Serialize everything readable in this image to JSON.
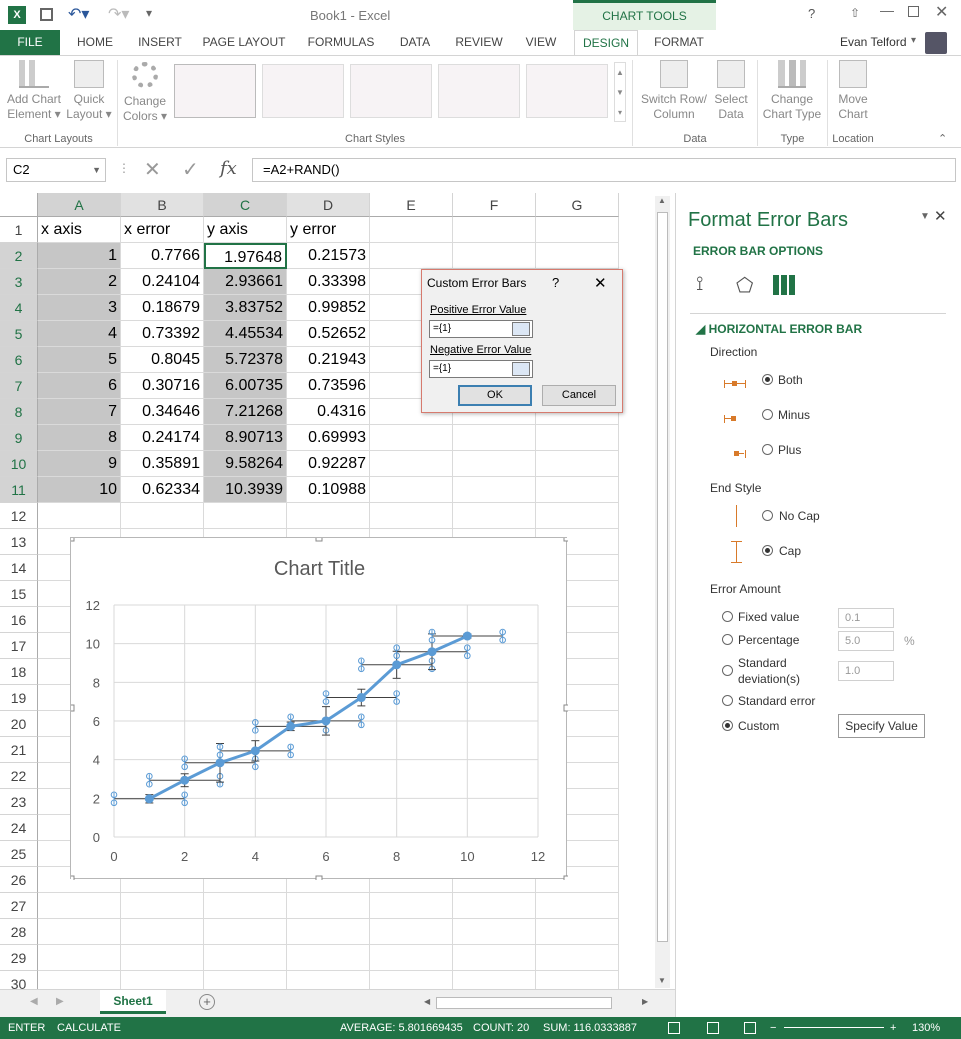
{
  "window": {
    "title": "Book1 - Excel",
    "chart_tools": "CHART TOOLS",
    "user": "Evan Telford"
  },
  "tabs": [
    "FILE",
    "HOME",
    "INSERT",
    "PAGE LAYOUT",
    "FORMULAS",
    "DATA",
    "REVIEW",
    "VIEW",
    "DESIGN",
    "FORMAT"
  ],
  "ribbon": {
    "add_chart": [
      "Add Chart",
      "Element ▾"
    ],
    "quick_layout": [
      "Quick",
      "Layout ▾"
    ],
    "change_colors": [
      "Change",
      "Colors ▾"
    ],
    "switch_row": [
      "Switch Row/",
      "Column"
    ],
    "select_data": [
      "Select",
      "Data"
    ],
    "change_type": [
      "Change",
      "Chart Type"
    ],
    "move_chart": [
      "Move",
      "Chart"
    ],
    "groups": {
      "layouts": "Chart Layouts",
      "styles": "Chart Styles",
      "data": "Data",
      "type": "Type",
      "location": "Location"
    }
  },
  "formula_bar": {
    "name_box": "C2",
    "fx": "fx",
    "formula": "=A2+RAND()"
  },
  "columns": [
    "A",
    "B",
    "C",
    "D",
    "E",
    "F",
    "G"
  ],
  "rows": [
    "1",
    "2",
    "3",
    "4",
    "5",
    "6",
    "7",
    "8",
    "9",
    "10",
    "11",
    "12",
    "13",
    "14",
    "15",
    "16",
    "17",
    "18",
    "19",
    "20",
    "21",
    "22",
    "23",
    "24",
    "25",
    "26",
    "27",
    "28",
    "29",
    "30"
  ],
  "sheet": {
    "headers": [
      "x axis",
      "x error",
      "y axis",
      "y error"
    ],
    "data": [
      [
        "1",
        "0.7766",
        "1.97648",
        "0.21573"
      ],
      [
        "2",
        "0.24104",
        "2.93661",
        "0.33398"
      ],
      [
        "3",
        "0.18679",
        "3.83752",
        "0.99852"
      ],
      [
        "4",
        "0.73392",
        "4.45534",
        "0.52652"
      ],
      [
        "5",
        "0.8045",
        "5.72378",
        "0.21943"
      ],
      [
        "6",
        "0.30716",
        "6.00735",
        "0.73596"
      ],
      [
        "7",
        "0.34646",
        "7.21268",
        "0.4316"
      ],
      [
        "8",
        "0.24174",
        "8.90713",
        "0.69993"
      ],
      [
        "9",
        "0.35891",
        "9.58264",
        "0.92287"
      ],
      [
        "10",
        "0.62334",
        "10.3939",
        "0.10988"
      ]
    ]
  },
  "chart": {
    "title": "Chart Title",
    "x_ticks": [
      "0",
      "2",
      "4",
      "6",
      "8",
      "10",
      "12"
    ],
    "y_ticks": [
      "0",
      "2",
      "4",
      "6",
      "8",
      "10",
      "12"
    ],
    "color": "#5b9bd5"
  },
  "chart_data": {
    "type": "scatter",
    "title": "Chart Title",
    "xlabel": "",
    "ylabel": "",
    "xlim": [
      0,
      12
    ],
    "ylim": [
      0,
      12
    ],
    "grid": true,
    "x": [
      1,
      2,
      3,
      4,
      5,
      6,
      7,
      8,
      9,
      10
    ],
    "y": [
      1.97648,
      2.93661,
      3.83752,
      4.45534,
      5.72378,
      6.00735,
      7.21268,
      8.90713,
      9.58264,
      10.3939
    ],
    "x_error": [
      0.7766,
      0.24104,
      0.18679,
      0.73392,
      0.8045,
      0.30716,
      0.34646,
      0.24174,
      0.35891,
      0.62334
    ],
    "y_error": [
      0.21573,
      0.33398,
      0.99852,
      0.52652,
      0.21943,
      0.73596,
      0.4316,
      0.69993,
      0.92287,
      0.10988
    ],
    "horizontal_error_bar_custom": {
      "positive": 1,
      "negative": 1
    }
  },
  "dialog": {
    "title": "Custom Error Bars",
    "help": "?",
    "close": "✕",
    "pos_label": "Positive Error Value",
    "pos_value": "={1}",
    "neg_label": "Negative Error Value",
    "neg_value": "={1}",
    "ok": "OK",
    "cancel": "Cancel"
  },
  "pane": {
    "title": "Format Error Bars",
    "section": "ERROR BAR OPTIONS",
    "subsection": "HORIZONTAL ERROR BAR",
    "direction": "Direction",
    "dir_options": [
      "Both",
      "Minus",
      "Plus"
    ],
    "end_style": "End Style",
    "end_options": [
      "No Cap",
      "Cap"
    ],
    "error_amount": "Error Amount",
    "fixed": "Fixed value",
    "fixed_val": "0.1",
    "percentage": "Percentage",
    "percentage_val": "5.0",
    "percent_sign": "%",
    "std_dev": [
      "Standard",
      "deviation(s)"
    ],
    "std_dev_val": "1.0",
    "std_err": "Standard error",
    "custom": "Custom",
    "specify": "Specify Value"
  },
  "sheet_tab": "Sheet1",
  "status": {
    "mode": "ENTER",
    "calc": "CALCULATE",
    "average": "AVERAGE: 5.801669435",
    "count": "COUNT: 20",
    "sum": "SUM: 116.0333887",
    "zoom": "130%"
  }
}
